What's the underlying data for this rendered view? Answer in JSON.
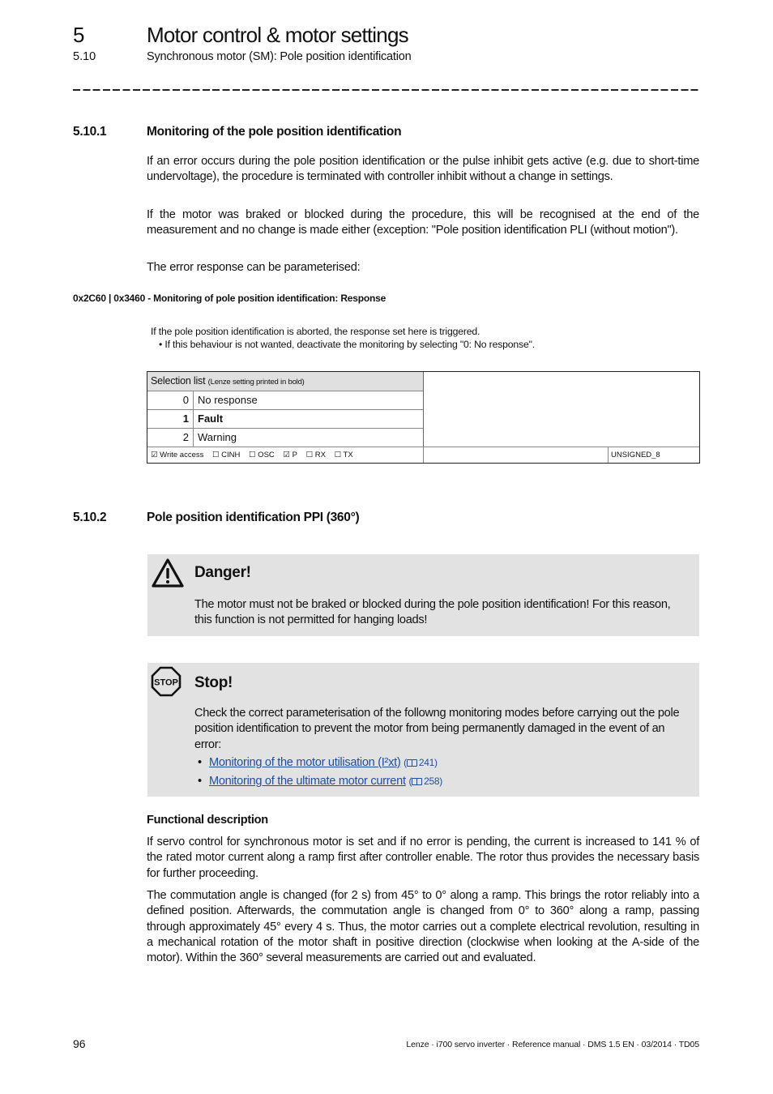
{
  "header": {
    "chapter_number": "5",
    "chapter_title": "Motor control & motor settings",
    "section_number": "5.10",
    "section_title": "Synchronous motor (SM): Pole position identification"
  },
  "section_5_10_1": {
    "number": "5.10.1",
    "title": "Monitoring of the pole position identification",
    "paragraphs": [
      "If an error occurs during the pole position identification or the pulse inhibit gets active (e.g. due to short-time undervoltage), the procedure is terminated with controller inhibit without a change in settings.",
      "If the motor was braked or blocked during the procedure, this will be recognised at the end of the measurement and no change is made either (exception: \"Pole position identification PLI (without motion\").",
      "The error response can be parameterised:"
    ],
    "parameter": {
      "heading": "0x2C60 | 0x3460 - Monitoring of pole position identification: Response",
      "description": "If the pole position identification is aborted, the response set here is triggered.",
      "bullet": "• If this behaviour is not wanted, deactivate the monitoring by selecting \"0: No response\".",
      "table": {
        "header": "Selection list",
        "header_note": "(Lenze setting printed in bold)",
        "rows": [
          {
            "value": "0",
            "label": "No response",
            "default": false
          },
          {
            "value": "1",
            "label": "Fault",
            "default": true
          },
          {
            "value": "2",
            "label": "Warning",
            "default": false
          }
        ],
        "flags": [
          {
            "label": "Write access",
            "checked": true,
            "text": "☑ Write access"
          },
          {
            "label": "CINH",
            "checked": false,
            "text": "☐ CINH"
          },
          {
            "label": "OSC",
            "checked": false,
            "text": "☐ OSC"
          },
          {
            "label": "P",
            "checked": true,
            "text": "☑ P"
          },
          {
            "label": "RX",
            "checked": false,
            "text": "☐ RX"
          },
          {
            "label": "TX",
            "checked": false,
            "text": "☐ TX"
          }
        ],
        "data_type": "UNSIGNED_8"
      }
    }
  },
  "section_5_10_2": {
    "number": "5.10.2",
    "title": "Pole position identification PPI (360°)",
    "danger": {
      "icon": "warning-triangle-icon",
      "title": "Danger!",
      "text": "The motor must not be braked or blocked during the pole position identification! For this reason, this function is not permitted for hanging loads!"
    },
    "stop": {
      "icon": "stop-sign-icon",
      "icon_text": "STOP",
      "title": "Stop!",
      "text": "Check the correct parameterisation of the followng monitoring modes before carrying out the pole position identification to prevent the motor from being permanently damaged in the event of an error:",
      "links": [
        {
          "label": "Monitoring of the motor utilisation (I²xt)",
          "page": "241"
        },
        {
          "label": "Monitoring of the ultimate motor current",
          "page": "258"
        }
      ]
    },
    "functional_heading": "Functional description",
    "paragraphs": [
      "If servo control for synchronous motor is set and if no error is pending, the current is increased to 141 % of the rated motor current along a ramp first after controller enable. The rotor thus provides the necessary basis for further proceeding.",
      "The commutation angle is changed (for 2 s) from 45° to 0° along a ramp. This brings the rotor reliably into a defined position. Afterwards, the commutation angle is changed from 0° to 360° along a ramp, passing through approximately 45° every 4 s. Thus, the motor carries out a complete electrical revolution, resulting in a mechanical rotation of the motor shaft in positive direction (clockwise when looking at the A-side of the motor). Within the 360° several measurements are carried out and evaluated."
    ]
  },
  "footer": {
    "page_number": "96",
    "text": "Lenze · i700 servo inverter · Reference manual · DMS 1.5 EN · 03/2014 · TD05"
  },
  "colors": {
    "link": "#1f4e9c",
    "notice_background": "#e2e2e2",
    "table_header_background": "#e0e0e0"
  }
}
